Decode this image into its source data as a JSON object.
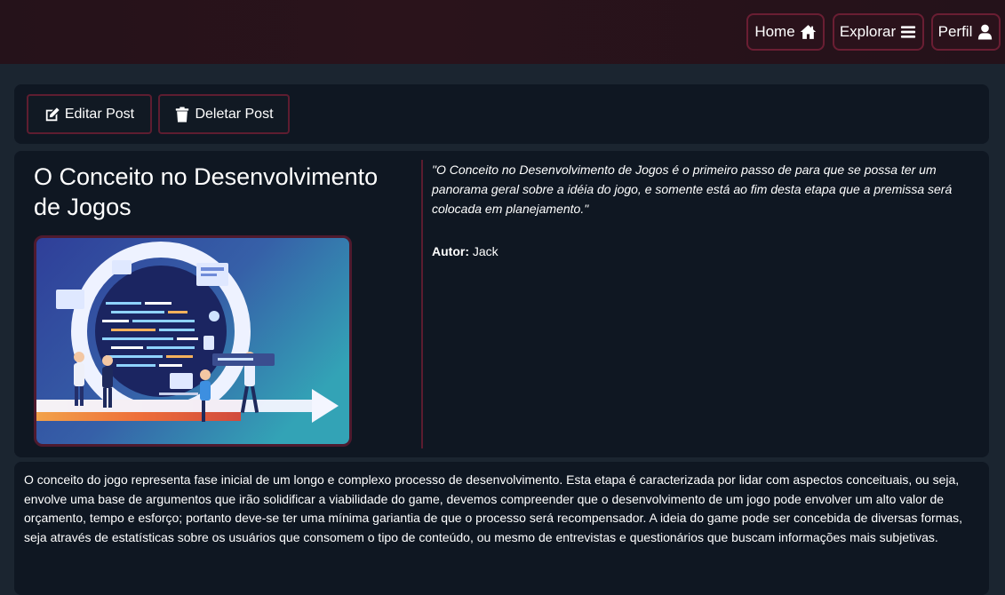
{
  "nav": {
    "items": [
      {
        "label": "Home",
        "icon": "home-icon"
      },
      {
        "label": "Explorar",
        "icon": "menu-icon"
      },
      {
        "label": "Perfil",
        "icon": "user-icon"
      }
    ]
  },
  "actions": {
    "edit_label": "Editar Post",
    "delete_label": "Deletar Post"
  },
  "post": {
    "title": "O Conceito no Desenvolvimento de Jogos",
    "quote": "\"O Conceito no Desenvolvimento de Jogos é o primeiro passo de para que se possa ter um panorama geral sobre a idéia do jogo, e somente está ao fim desta etapa que a premissa será colocada em planejamento.\"",
    "author_label": "Autor:",
    "author_name": "Jack",
    "body": "O conceito do jogo representa fase inicial de um longo e complexo processo de desenvolvimento. Esta etapa é caracterizada por lidar com aspectos conceituais, ou seja, envolve uma base de argumentos que irão solidificar a viabilidade do game, devemos compreender que o desenvolvimento de um jogo pode envolver um alto valor de orçamento, tempo e esforço; portanto deve-se ter uma mínima gariantia de que o processo será recompensador. A ideia do game pode ser concebida de diversas formas, seja através de estatísticas sobre os usuários que consomem o tipo de conteúdo, ou mesmo de entrevistas e questionários que buscam informações mais subjetivas."
  },
  "colors": {
    "page_bg": "#1b2530",
    "panel_bg": "#0f1722",
    "accent_border": "#6a1e33",
    "text": "#ffffff"
  }
}
